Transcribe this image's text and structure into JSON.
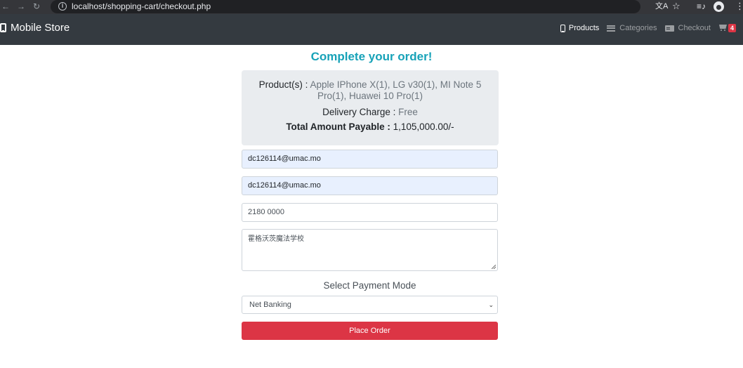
{
  "browser": {
    "url": "localhost/shopping-cart/checkout.php"
  },
  "navbar": {
    "brand": "Mobile Store",
    "links": {
      "products": "Products",
      "categories": "Categories",
      "checkout": "Checkout"
    },
    "cart_count": "4"
  },
  "checkout": {
    "heading": "Complete your order!",
    "products_label": "Product(s) :",
    "products_value": "Apple IPhone X(1), LG v30(1), MI Note 5 Pro(1), Huawei 10 Pro(1)",
    "delivery_label": "Delivery Charge :",
    "delivery_value": "Free",
    "total_label": "Total Amount Payable :",
    "total_value": "1,105,000.00/-"
  },
  "form": {
    "name_value": "dc126114@umac.mo",
    "email_value": "dc126114@umac.mo",
    "phone_value": "2180 0000",
    "address_value": "霍格沃茨魔法学校",
    "payment_label": "Select Payment Mode",
    "payment_selected": "Net Banking",
    "submit_label": "Place Order"
  },
  "colors": {
    "navbar": "#343a40",
    "heading": "#17a2b8",
    "summary_bg": "#e9ecef",
    "submit_bg": "#dc3545",
    "badge": "#dc3545"
  },
  "icons": [
    "back-arrow-icon",
    "forward-arrow-icon",
    "reload-icon",
    "info-icon",
    "translate-icon",
    "star-icon",
    "media-icon",
    "profile-icon",
    "menu-icon",
    "phone-icon",
    "list-icon",
    "card-icon",
    "cart-icon",
    "chevron-down-icon"
  ]
}
